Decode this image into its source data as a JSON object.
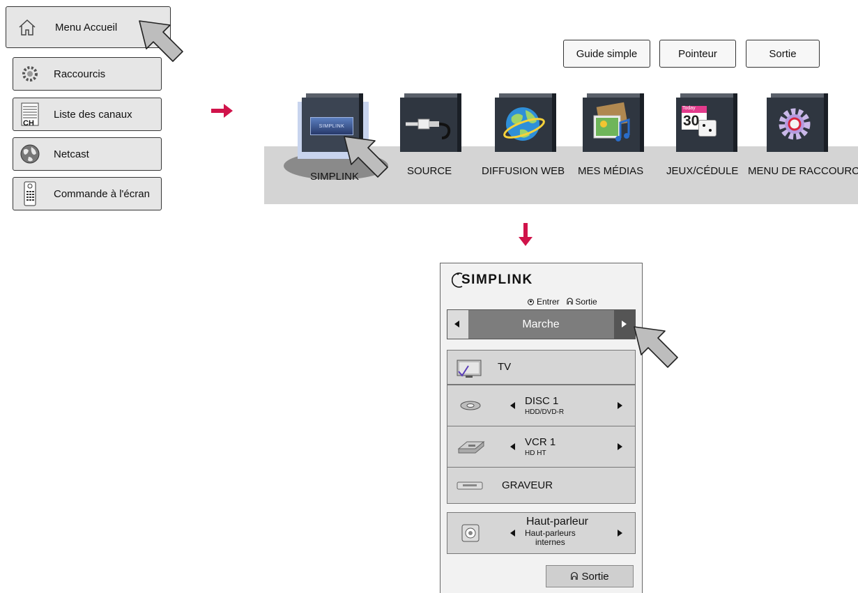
{
  "left_menu": {
    "items": [
      {
        "label": "Menu Accueil",
        "icon": "home-icon"
      },
      {
        "label": "Raccourcis",
        "icon": "gear-icon"
      },
      {
        "label": "Liste des canaux",
        "icon": "channel-list-icon",
        "icon_text": "CH"
      },
      {
        "label": "Netcast",
        "icon": "globe-icon"
      },
      {
        "label": "Commande à l'écran",
        "icon": "remote-icon"
      }
    ]
  },
  "top_buttons": {
    "guide": "Guide simple",
    "pointer": "Pointeur",
    "exit": "Sortie"
  },
  "home_bar": {
    "items": [
      {
        "label": "SIMPLINK",
        "icon": "simplink-icon",
        "icon_text": "SIMPLINK"
      },
      {
        "label": "SOURCE",
        "icon": "source-cable-icon"
      },
      {
        "label": "DIFFUSION WEB",
        "icon": "web-globe-icon"
      },
      {
        "label": "MES MÉDIAS",
        "icon": "media-icon"
      },
      {
        "label": "JEUX/CÉDULE",
        "icon": "calendar-dice-icon",
        "icon_text_small": "Today",
        "icon_text": "30"
      },
      {
        "label": "MENU DE RACCOURCI",
        "icon": "settings-gear-icon"
      }
    ]
  },
  "simplink_panel": {
    "logo": "SIMPLINK",
    "enter_hint": "Entrer",
    "exit_hint": "Sortie",
    "power_state": "Marche",
    "devices": [
      {
        "name": "TV",
        "icon": "tv-icon"
      },
      {
        "name": "DISC 1",
        "sub": "HDD/DVD-R",
        "icon": "disc-icon"
      },
      {
        "name": "VCR 1",
        "sub": "HD HT",
        "icon": "vcr-icon"
      },
      {
        "name": "GRAVEUR",
        "icon": "recorder-icon"
      }
    ],
    "speaker": {
      "name": "Haut-parleur",
      "sub": "Haut-parleurs\ninternes",
      "icon": "speaker-icon"
    },
    "exit_button": "Sortie"
  },
  "colors": {
    "arrow": "#d0134a",
    "panel_bg": "#f2f2f2",
    "row_bg": "#d6d6d6",
    "bar_bg": "#d4d4d4"
  }
}
